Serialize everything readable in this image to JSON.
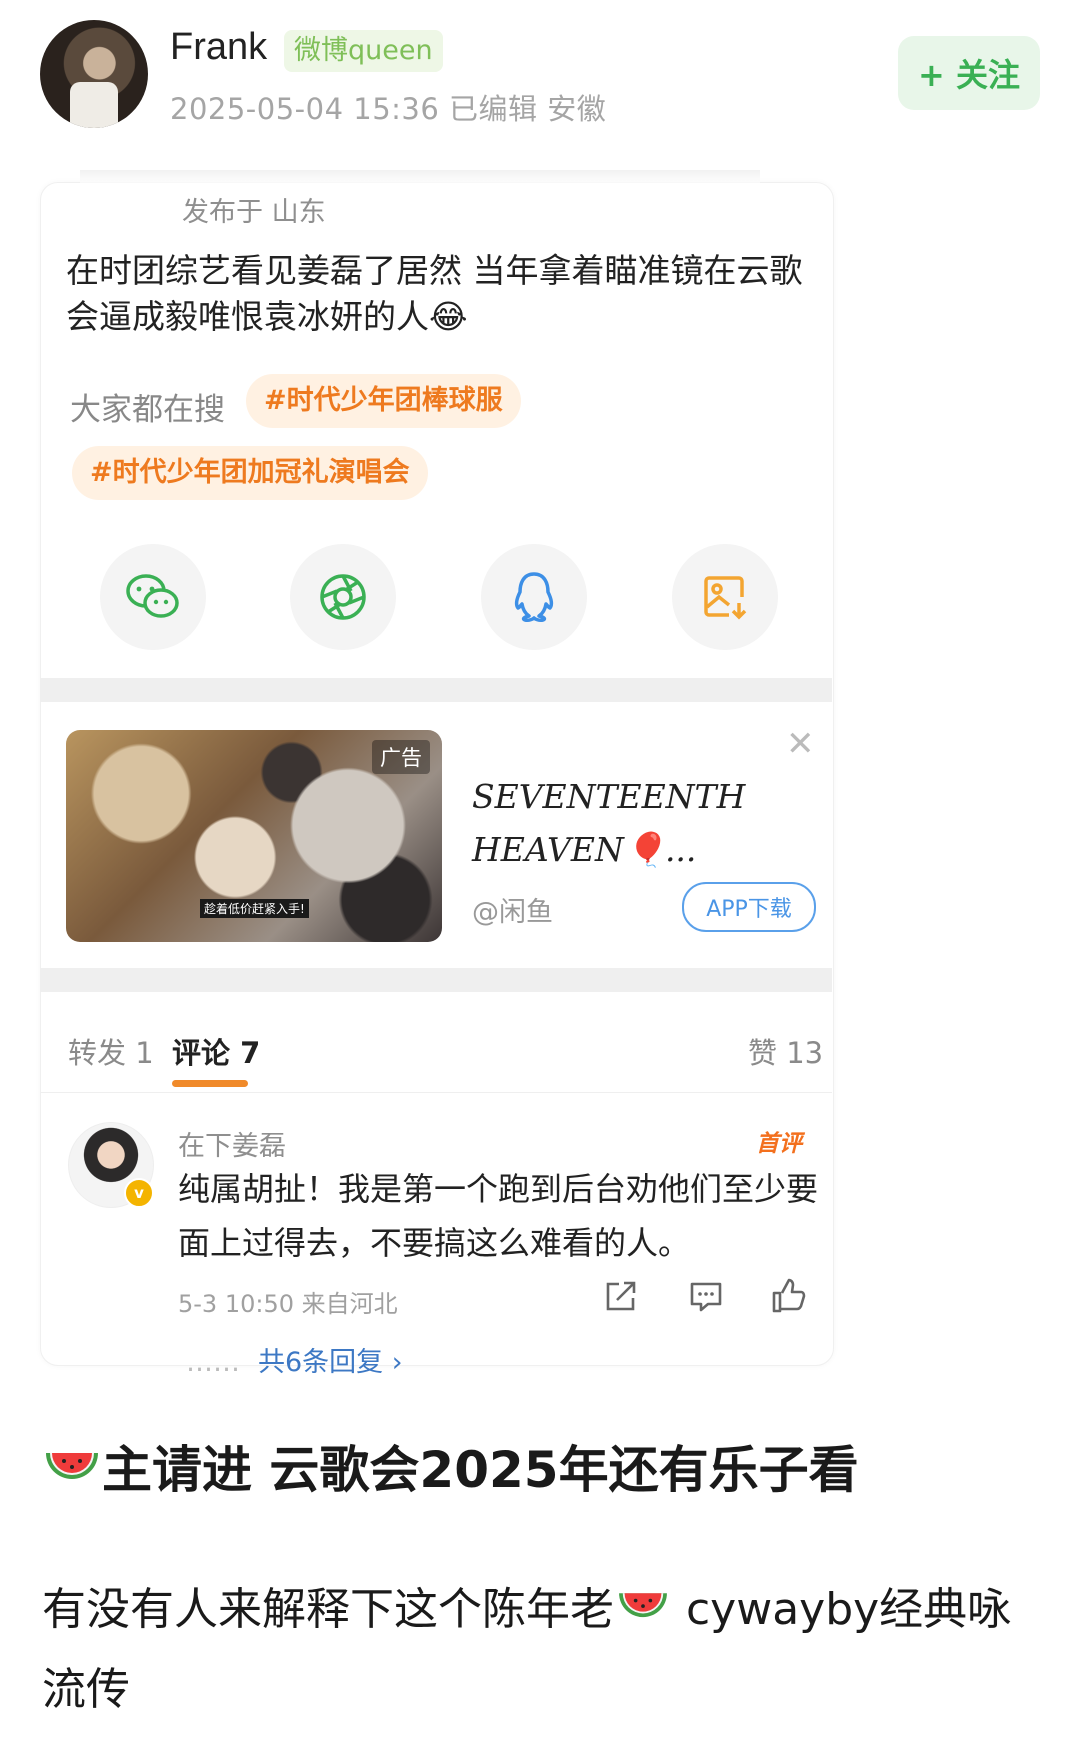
{
  "header": {
    "username": "Frank",
    "badge": "微博queen",
    "meta": "2025-05-04 15:36  已编辑  安徽",
    "follow_label": "+ 关注"
  },
  "post": {
    "posted_at": "发布于 山东",
    "text": "在时团综艺看见姜磊了居然 当年拿着瞄准镜在云歌会逼成毅唯恨袁冰妍的人😂",
    "search_label": "大家都在搜",
    "tags": [
      "#时代少年团棒球服",
      "#时代少年团加冠礼演唱会"
    ],
    "share_icons": [
      "wechat-icon",
      "moments-icon",
      "qq-icon",
      "save-image-icon"
    ]
  },
  "ad": {
    "tag": "广告",
    "caption": "趁着低价赶紧入手!",
    "title_line1": "SEVENTEENTH",
    "title_line2": "HEAVEN🎈...",
    "source": "@闲鱼",
    "button": "APP下载"
  },
  "tabs": {
    "repost": "转发 1",
    "comments": "评论 7",
    "likes": "赞 13"
  },
  "comment": {
    "name": "在下姜磊",
    "first_badge": "首评",
    "text": "纯属胡扯！我是第一个跑到后台劝他们至少要面上过得去，不要搞这么难看的人。",
    "time": "5-3 10:50  来自河北",
    "replies": "共6条回复 ›",
    "dots": "……"
  },
  "body": {
    "headline": "主请进 云歌会2025年还有乐子看",
    "text_part1": "有没有人来解释下这个陈年老",
    "text_part2": " cywayby经典咏流传"
  },
  "colors": {
    "accent_green": "#3ab054",
    "tag_orange": "#ee7a1f",
    "link_blue": "#3d78c4"
  }
}
